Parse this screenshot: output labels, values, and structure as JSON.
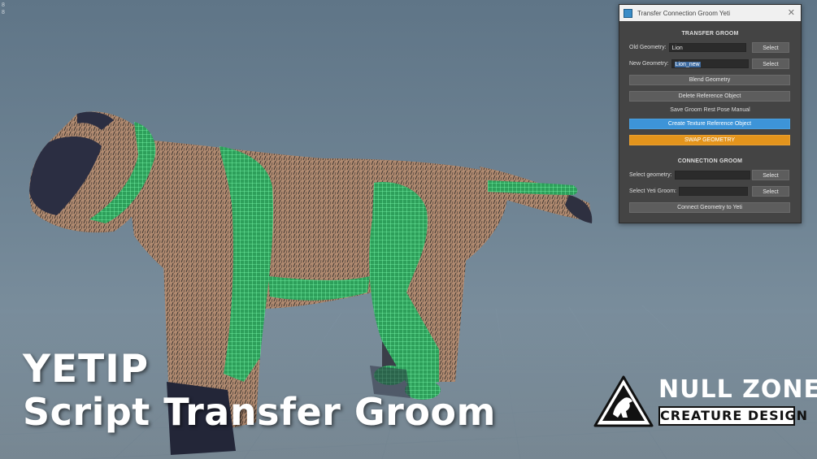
{
  "viewport": {
    "corner_text_1": "8",
    "corner_text_2": "8"
  },
  "tool_window": {
    "title": "Transfer Connection Groom Yeti",
    "close_glyph": "✕",
    "transfer_section": {
      "heading": "TRANSFER GROOM",
      "old_geometry_label": "Old Geometry:",
      "old_geometry_value": "Lion",
      "new_geometry_label": "New Geometry:",
      "new_geometry_value": "Lion_new",
      "select_label": "Select",
      "blend_geometry_label": "Blend Geometry",
      "delete_reference_label": "Delete Reference Object",
      "save_rest_pose_text": "Save Groom Rest Pose Manual",
      "create_texture_reference_label": "Create Texture Reference Object",
      "swap_geometry_label": "SWAP GEOMETRY"
    },
    "connection_section": {
      "heading": "CONNECTION GROOM",
      "select_geometry_label": "Select geometry:",
      "select_geometry_value": "",
      "select_yeti_groom_label": "Select Yeti Groom:",
      "select_yeti_groom_value": "",
      "select_label": "Select",
      "connect_label": "Connect Geometry to Yeti"
    },
    "colors": {
      "blue_button": "#3d94d8",
      "orange_button": "#e3941c",
      "window_bg": "#444444"
    }
  },
  "overlay": {
    "title_line1": "YETIP",
    "title_line2": "Script Transfer Groom"
  },
  "brand": {
    "name": "NULL ZONE",
    "subtitle": "CREATURE DESIGN",
    "logo_icon": "lion-emblem-icon"
  }
}
